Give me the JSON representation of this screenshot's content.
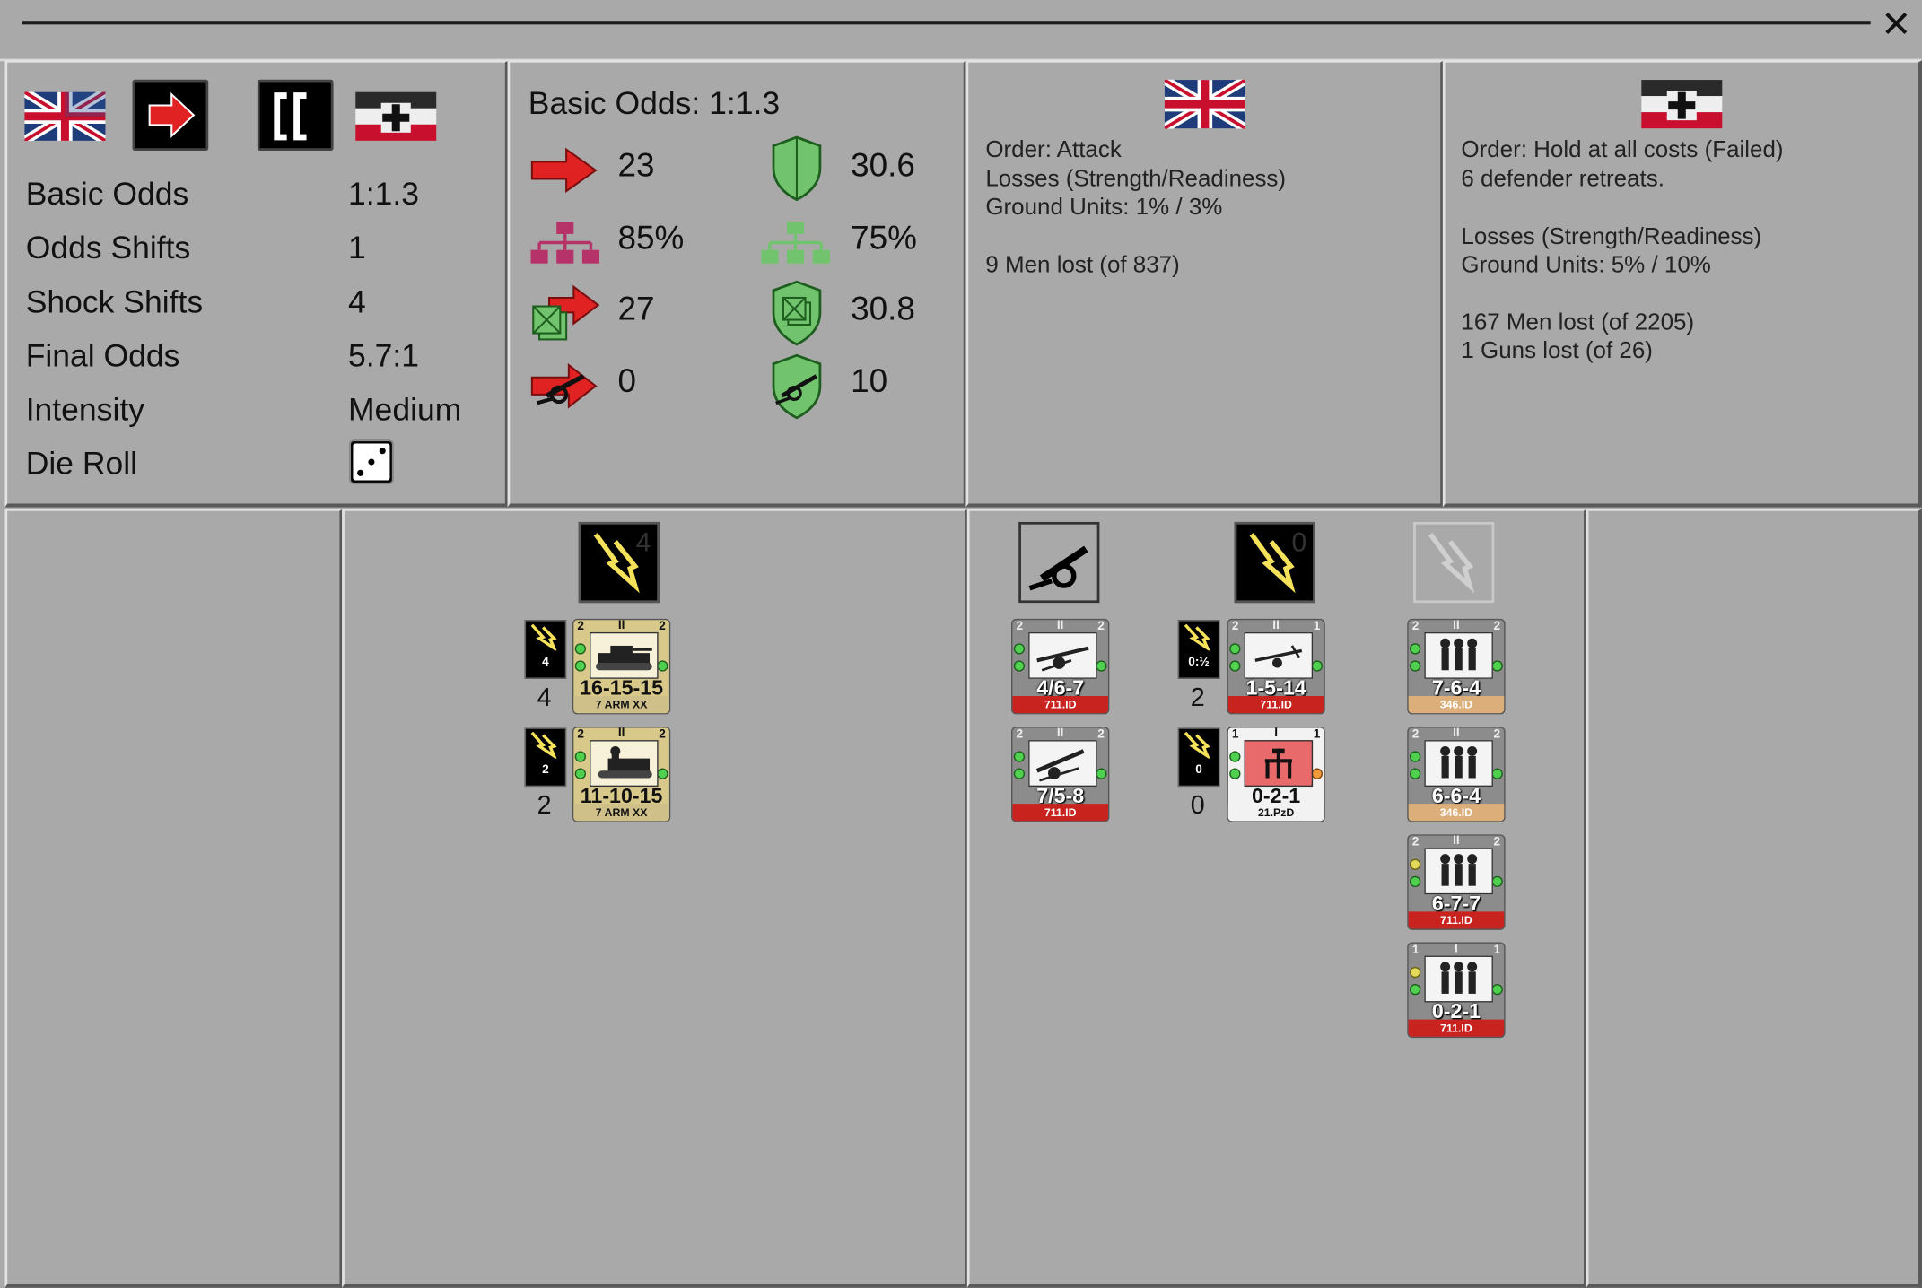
{
  "summary": {
    "rows": [
      {
        "label": "Basic Odds",
        "value": "1:1.3"
      },
      {
        "label": "Odds Shifts",
        "value": "1"
      },
      {
        "label": "Shock Shifts",
        "value": "4"
      },
      {
        "label": "Final Odds",
        "value": "5.7:1"
      },
      {
        "label": "Intensity",
        "value": "Medium"
      },
      {
        "label": "Die Roll",
        "value": ""
      }
    ],
    "die_face": 3
  },
  "odds": {
    "title": "Basic Odds: 1:1.3",
    "attacker": {
      "strength": "23",
      "hq": "85%",
      "combined": "27",
      "artillery": "0"
    },
    "defender": {
      "strength": "30.6",
      "hq": "75%",
      "combined": "30.8",
      "artillery": "10"
    }
  },
  "attacker_report": {
    "line1": "Order: Attack",
    "line2": "Losses (Strength/Readiness)",
    "line3": "Ground Units: 1% / 3%",
    "line4": "9 Men lost (of 837)"
  },
  "defender_report": {
    "line1": "Order: Hold at all costs (Failed)",
    "line2": "6 defender retreats.",
    "line3": "Losses (Strength/Readiness)",
    "line4": "Ground Units: 5% / 10%",
    "line5": "167 Men lost (of 2205)",
    "line6": "1 Guns lost (of 26)"
  },
  "attacker_units": {
    "shock_header": "4",
    "units": [
      {
        "shock": "4",
        "shock_below": "4",
        "value": "16-15-15",
        "division": "7 ARM XX",
        "size": "II"
      },
      {
        "shock": "2",
        "shock_below": "2",
        "value": "11-10-15",
        "division": "7 ARM XX",
        "size": "II"
      }
    ]
  },
  "defender_units": {
    "artillery": [
      {
        "value": "4/6-7",
        "division": "711.ID",
        "size": "II"
      },
      {
        "value": "7/5-8",
        "division": "711.ID",
        "size": "II"
      }
    ],
    "shock_header": "0",
    "shock_units": [
      {
        "shock": "0:½",
        "shock_below": "2",
        "value": "1-5-14",
        "division": "711.ID",
        "size": "II"
      },
      {
        "shock": "0",
        "shock_below": "0",
        "value": "0-2-1",
        "division": "21.PzD",
        "size": "I"
      }
    ],
    "infantry": [
      {
        "value": "7-6-4",
        "division": "346.ID",
        "size": "II"
      },
      {
        "value": "6-6-4",
        "division": "346.ID",
        "size": "II"
      },
      {
        "value": "6-7-7",
        "division": "711.ID",
        "size": "II"
      },
      {
        "value": "0-2-1",
        "division": "711.ID",
        "size": "I"
      }
    ]
  },
  "colors": {
    "british_counter": "#d8c889",
    "british_div_band": "#cfc08a",
    "german_counter": "#8c8c8c",
    "german_div_band_711": "#c9231f",
    "german_div_band_346": "#dcae7a",
    "panel_bg": "#a9a9a9",
    "attack_red": "#e02222",
    "defense_green": "#72c36e"
  }
}
